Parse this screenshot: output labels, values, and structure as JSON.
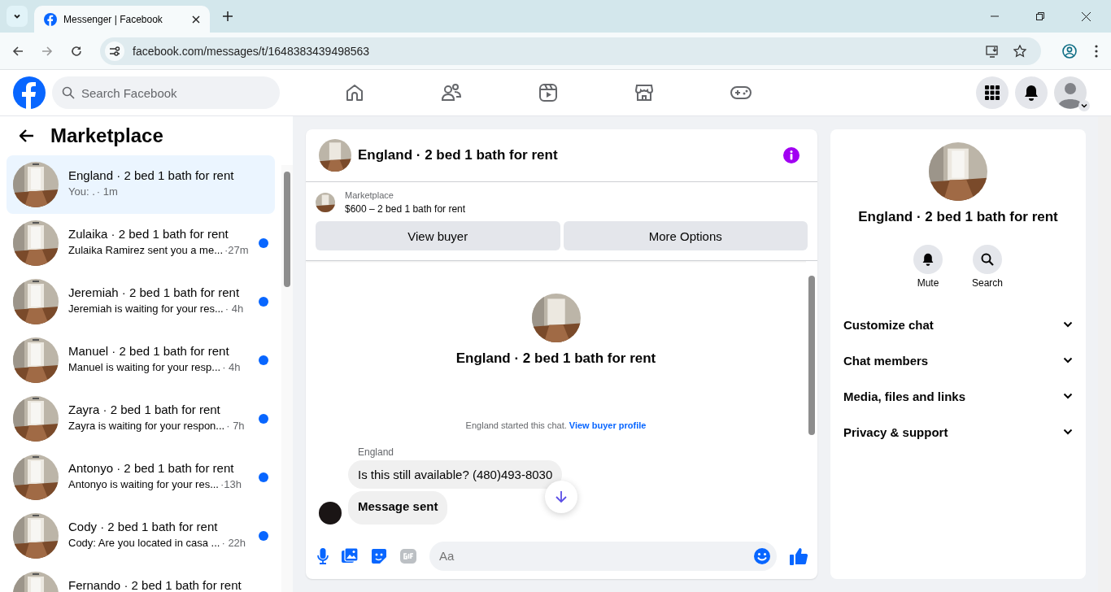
{
  "browser": {
    "tab_title": "Messenger | Facebook",
    "url": "facebook.com/messages/t/1648383439498563"
  },
  "header": {
    "search_placeholder": "Search Facebook"
  },
  "sidebar": {
    "title": "Marketplace",
    "conversations": [
      {
        "title": "England · 2 bed 1 bath for rent",
        "preview": "You: .",
        "time": "· 1m",
        "selected": true,
        "unread": false
      },
      {
        "title": "Zulaika · 2 bed 1 bath for rent",
        "preview": "Zulaika Ramirez sent you a me...",
        "time": "·27m",
        "selected": false,
        "unread": true
      },
      {
        "title": "Jeremiah · 2 bed 1 bath for rent",
        "preview": "Jeremiah is waiting for your res...",
        "time": "· 4h",
        "selected": false,
        "unread": true
      },
      {
        "title": "Manuel · 2 bed 1 bath for rent",
        "preview": "Manuel is waiting for your resp...",
        "time": "· 4h",
        "selected": false,
        "unread": true
      },
      {
        "title": "Zayra · 2 bed 1 bath for rent",
        "preview": "Zayra is waiting for your respon...",
        "time": "· 7h",
        "selected": false,
        "unread": true
      },
      {
        "title": "Antonyo · 2 bed 1 bath for rent",
        "preview": "Antonyo is waiting for your res...",
        "time": "·13h",
        "selected": false,
        "unread": true
      },
      {
        "title": "Cody · 2 bed 1 bath for rent",
        "preview": "Cody: Are you located in casa ...",
        "time": "· 22h",
        "selected": false,
        "unread": true
      },
      {
        "title": "Fernando · 2 bed 1 bath for rent",
        "selected": false,
        "unread": false
      }
    ]
  },
  "chat": {
    "title": "England · 2 bed 1 bath for rent",
    "listing": {
      "label": "Marketplace",
      "summary": "$600 – 2 bed 1 bath for rent",
      "buttons": [
        "View buyer",
        "More Options"
      ]
    },
    "intro_title": "England · 2 bed 1 bath for rent",
    "intro_note": "England started this chat.",
    "intro_link": "View buyer profile",
    "sender": "England",
    "messages": [
      {
        "text": "Is this still available? (480)493-8030",
        "bold": false
      },
      {
        "text": "Message sent",
        "bold": true
      }
    ],
    "composer": {
      "placeholder": "Aa"
    }
  },
  "details": {
    "title": "England · 2 bed 1 bath for rent",
    "actions": [
      {
        "kind": "bell",
        "label": "Mute"
      },
      {
        "kind": "search",
        "label": "Search"
      }
    ],
    "sections": [
      "Customize chat",
      "Chat members",
      "Media, files and links",
      "Privacy & support"
    ]
  }
}
